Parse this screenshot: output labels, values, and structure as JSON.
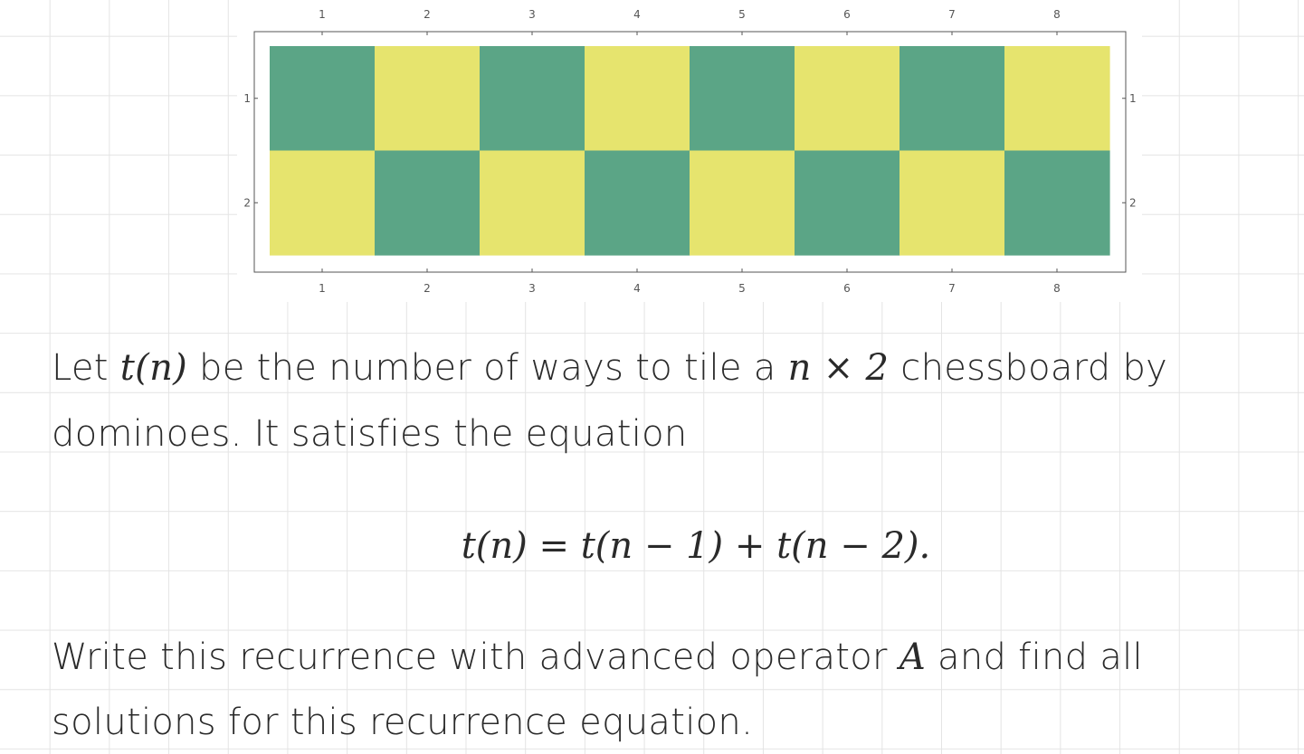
{
  "figure": {
    "rows": 2,
    "cols": 8,
    "x_tick_labels": [
      "1",
      "2",
      "3",
      "4",
      "5",
      "6",
      "7",
      "8"
    ],
    "y_tick_labels": [
      "1",
      "2"
    ],
    "colors": {
      "green": "#5ba586",
      "yellow": "#e6e46e",
      "frame": "#555555"
    }
  },
  "paragraph_1": {
    "line_1": {
      "before_t": "Let ",
      "t_of_n": "t(n)",
      "mid": " be the number of ways to tile a ",
      "dims": "n × 2",
      "after": " chessboard by"
    },
    "line_2": "dominoes.  It satisfies the equation"
  },
  "equation": "t(n) = t(n − 1) + t(n − 2).",
  "paragraph_2": {
    "line_1": {
      "before": "Write this recurrence with advanced operator ",
      "operator": "A",
      "after": " and find all"
    },
    "line_2": "solutions for this recurrence equation."
  }
}
